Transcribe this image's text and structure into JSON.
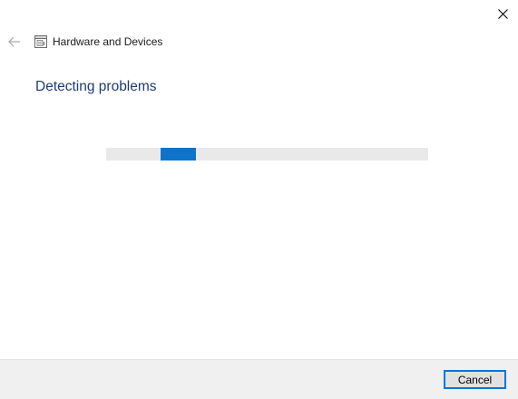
{
  "window": {
    "title": "Hardware and Devices",
    "close_icon": "close-icon",
    "back_icon": "back-arrow-icon",
    "app_icon": "hardware-devices-icon"
  },
  "main": {
    "heading": "Detecting problems",
    "progress": {
      "type": "indeterminate",
      "track_color": "#e9e9e9",
      "fill_color": "#0f74c9",
      "indicator_fraction": 0.11,
      "indicator_offset_fraction": 0.17
    }
  },
  "footer": {
    "cancel_label": "Cancel"
  },
  "colors": {
    "accent": "#0078d7",
    "heading": "#1f3b73",
    "footer_bg": "#f0f0f0"
  }
}
